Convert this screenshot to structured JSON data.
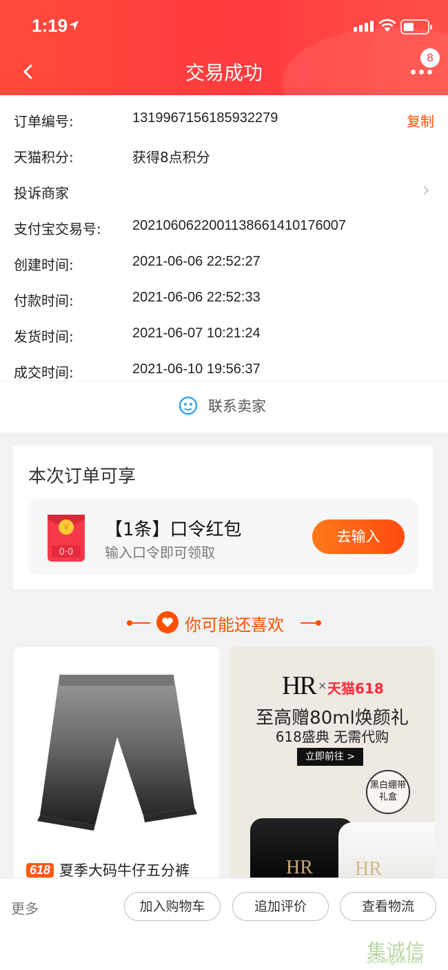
{
  "status_bar": {
    "time": "1:19"
  },
  "header": {
    "title": "交易成功",
    "badge_count": "8"
  },
  "order_info": {
    "order_no_label": "订单编号:",
    "order_no": "1319967156185932279",
    "copy_label": "复制",
    "points_label": "天猫积分:",
    "points_value": "获得8点积分",
    "complaint_label": "投诉商家",
    "alipay_label": "支付宝交易号:",
    "alipay_no": "2021060622001138661410176007",
    "created_label": "创建时间:",
    "created_time": "2021-06-06 22:52:27",
    "paid_label": "付款时间:",
    "paid_time": "2021-06-06 22:52:33",
    "shipped_label": "发货时间:",
    "shipped_time": "2021-06-07 10:21:24",
    "closed_label": "成交时间:",
    "closed_time": "2021-06-10 19:56:37"
  },
  "contact": {
    "label": "联系卖家"
  },
  "benefit": {
    "title": "本次订单可享",
    "item_name": "【1条】口令红包",
    "item_desc": "输入口令即可领取",
    "button": "去输入"
  },
  "recommend": {
    "title": "你可能还喜欢",
    "left_product": {
      "tag": "618",
      "name": "夏季大码牛仔五分裤"
    },
    "right_ad": {
      "brand": "HR",
      "x": "×",
      "partner": "天猫618",
      "line1": "至高赠80ml焕颜礼",
      "line2": "618盛典 无需代购",
      "button": "立即前往 >",
      "badge": "黑白绷带礼盒"
    }
  },
  "bottom_bar": {
    "more": "更多",
    "add_cart": "加入购物车",
    "add_review": "追加评价",
    "logistics": "查看物流"
  },
  "watermark": {
    "logo": "集诚信",
    "url": "JiChengXin.com"
  },
  "colors": {
    "accent": "#ff5000",
    "header": "#ff3b3f"
  }
}
